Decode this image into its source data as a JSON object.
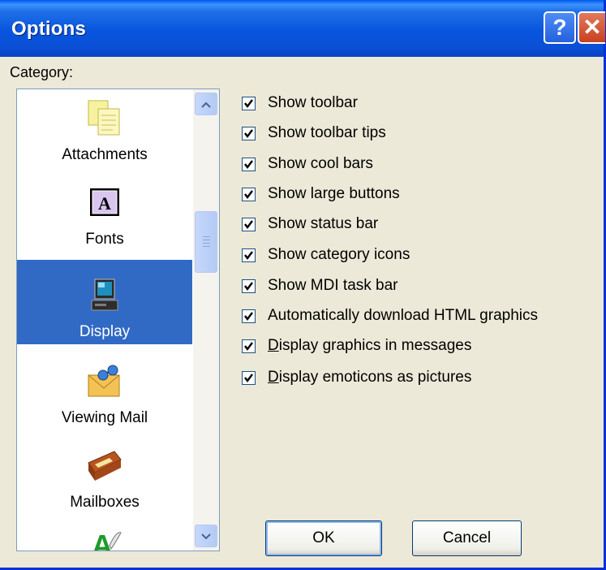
{
  "window": {
    "title": "Options",
    "help_glyph": "?",
    "close_glyph": "✕"
  },
  "category_label": "Category:",
  "categories": [
    {
      "label": "Attachments",
      "icon": "attachments-icon",
      "selected": false
    },
    {
      "label": "Fonts",
      "icon": "fonts-icon",
      "selected": false
    },
    {
      "label": "Display",
      "icon": "display-icon",
      "selected": true
    },
    {
      "label": "Viewing Mail",
      "icon": "viewing-mail-icon",
      "selected": false
    },
    {
      "label": "Mailboxes",
      "icon": "mailboxes-icon",
      "selected": false
    },
    {
      "label": "",
      "icon": "spelling-icon",
      "selected": false
    }
  ],
  "options": [
    {
      "pre": "",
      "acc": "",
      "post": "Show toolbar",
      "checked": true
    },
    {
      "pre": "",
      "acc": "",
      "post": "Show toolbar tips",
      "checked": true
    },
    {
      "pre": "",
      "acc": "",
      "post": "Show cool bars",
      "checked": true
    },
    {
      "pre": "",
      "acc": "",
      "post": "Show large buttons",
      "checked": true
    },
    {
      "pre": "",
      "acc": "",
      "post": "Show status bar",
      "checked": true
    },
    {
      "pre": "",
      "acc": "",
      "post": "Show category icons",
      "checked": true
    },
    {
      "pre": "",
      "acc": "",
      "post": "Show MDI task bar",
      "checked": true
    },
    {
      "pre": "",
      "acc": "",
      "post": "Automatically download HTML graphics",
      "checked": true
    },
    {
      "pre": "",
      "acc": "D",
      "post": "isplay graphics in messages",
      "checked": true
    },
    {
      "pre": "",
      "acc": "D",
      "post": "isplay emoticons as pictures",
      "checked": true
    }
  ],
  "buttons": {
    "ok": "OK",
    "cancel": "Cancel"
  },
  "colors": {
    "selection": "#316ac5",
    "titlebar": "#0855dd",
    "face": "#ece9d8"
  }
}
